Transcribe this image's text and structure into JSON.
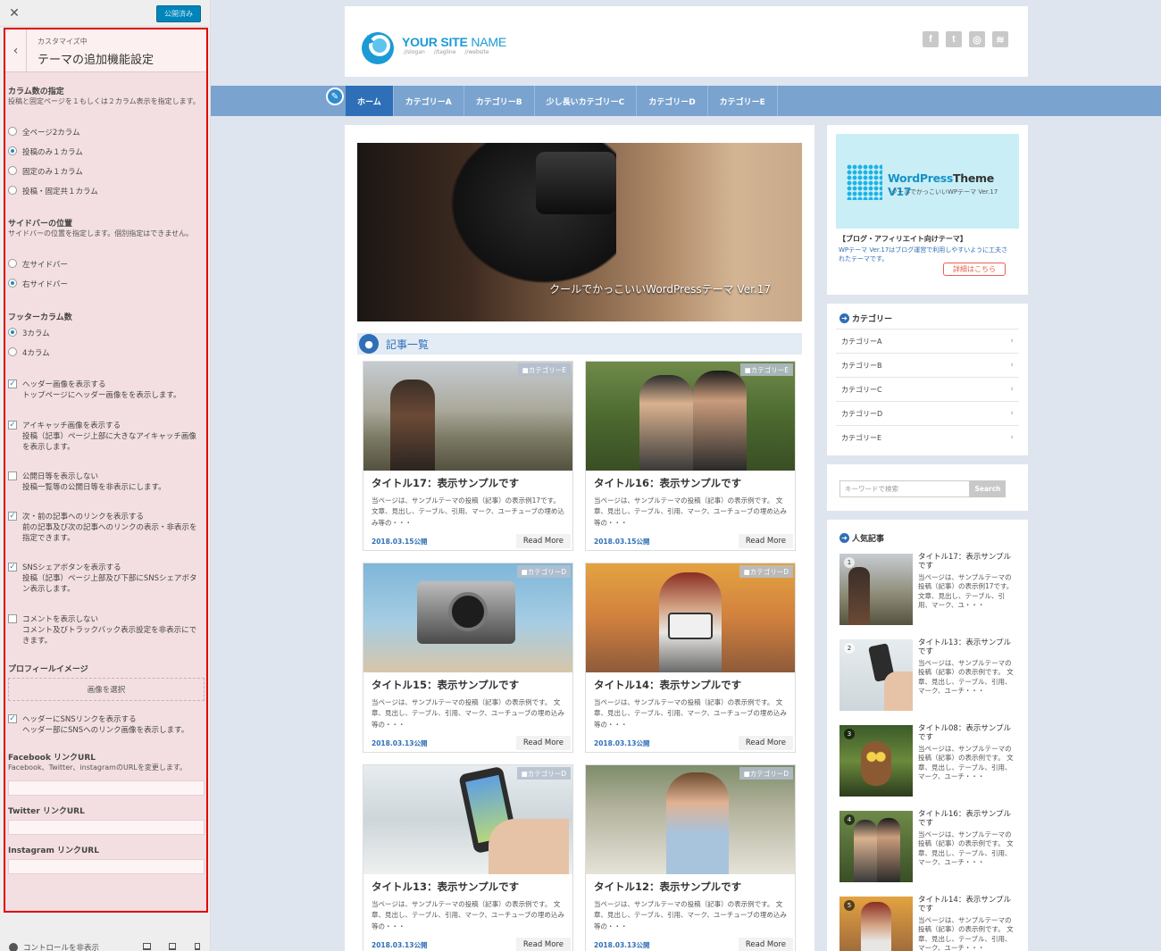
{
  "customizer": {
    "close_icon": "close-icon",
    "publish_label": "公開済み",
    "back_icon": "chevron-left-icon",
    "subtitle": "カスタマイズ中",
    "title": "テーマの追加機能設定",
    "column": {
      "heading": "カラム数の指定",
      "desc": "投稿と固定ページを１もしくは２カラム表示を指定します。",
      "options": [
        "全ページ2カラム",
        "投稿のみ１カラム",
        "固定のみ１カラム",
        "投稿・固定共１カラム"
      ],
      "selected": 1
    },
    "sidebar": {
      "heading": "サイドバーの位置",
      "desc": "サイドバーの位置を指定します。個別指定はできません。",
      "options": [
        "左サイドバー",
        "右サイドバー"
      ],
      "selected": 1
    },
    "footer": {
      "heading": "フッターカラム数",
      "options": [
        "3カラム",
        "4カラム"
      ],
      "selected": 0
    },
    "checks": [
      {
        "label": "ヘッダー画像を表示する",
        "desc": "トップページにヘッダー画像をを表示します。",
        "checked": true
      },
      {
        "label": "アイキャッチ画像を表示する",
        "desc": "投稿（記事）ページ上部に大きなアイキャッチ画像を表示します。",
        "checked": true
      },
      {
        "label": "公開日等を表示しない",
        "desc": "投稿一覧等の公開日等を非表示にします。",
        "checked": false
      },
      {
        "label": "次・前の記事へのリンクを表示する",
        "desc": "前の記事及び次の記事へのリンクの表示・非表示を指定できます。",
        "checked": true
      },
      {
        "label": "SNSシェアボタンを表示する",
        "desc": "投稿（記事）ページ上部及び下部にSNSシェアボタン表示します。",
        "checked": true
      },
      {
        "label": "コメントを表示しない",
        "desc": "コメント及びトラックバック表示設定を非表示にできます。",
        "checked": false
      }
    ],
    "profile": {
      "heading": "プロフィールイメージ",
      "button": "画像を選択"
    },
    "sns_check": {
      "label": "ヘッダーにSNSリンクを表示する",
      "desc": "ヘッダー部にSNSへのリンク画像を表示します。",
      "checked": true
    },
    "facebook": {
      "heading": "Facebook リンクURL",
      "desc": "Facebook、Twitter、instagramのURLを変更します。",
      "value": ""
    },
    "twitter": {
      "heading": "Twitter リンクURL",
      "value": ""
    },
    "instagram": {
      "heading": "Instagram リンクURL",
      "value": ""
    },
    "bottom": {
      "hide_label": "コントロールを非表示"
    }
  },
  "site": {
    "logo_main": "YOUR SITE",
    "logo_thin": "NAME",
    "logo_tags": "//slogan //tagline //website",
    "social": [
      "f",
      "t",
      "◎",
      "≋"
    ],
    "nav": [
      "ホーム",
      "カテゴリーA",
      "カテゴリーB",
      "少し長いカテゴリーC",
      "カテゴリーD",
      "カテゴリーE"
    ],
    "nav_active": 0,
    "hero_caption": "クールでかっこいいWordPressテーマ Ver.17",
    "section_title": "記事一覧",
    "posts": [
      {
        "title": "タイトル17：表示サンプルです",
        "excerpt": "当ページは、サンプルテーマの投稿（記事）の表示例17です。 文章、見出し、テーブル、引用、マーク、ユーチューブの埋め込み等の・・・",
        "date": "2018.03.15公開",
        "category": "カテゴリーE",
        "more": "Read More"
      },
      {
        "title": "タイトル16：表示サンプルです",
        "excerpt": "当ページは、サンプルテーマの投稿（記事）の表示例です。 文章、見出し、テーブル、引用、マーク、ユーチューブの埋め込み等の・・・",
        "date": "2018.03.15公開",
        "category": "カテゴリーE",
        "more": "Read More"
      },
      {
        "title": "タイトル15：表示サンプルです",
        "excerpt": "当ページは、サンプルテーマの投稿（記事）の表示例です。 文章、見出し、テーブル、引用、マーク、ユーチューブの埋め込み等の・・・",
        "date": "2018.03.13公開",
        "category": "カテゴリーD",
        "more": "Read More"
      },
      {
        "title": "タイトル14：表示サンプルです",
        "excerpt": "当ページは、サンプルテーマの投稿（記事）の表示例です。 文章、見出し、テーブル、引用、マーク、ユーチューブの埋め込み等の・・・",
        "date": "2018.03.13公開",
        "category": "カテゴリーD",
        "more": "Read More"
      },
      {
        "title": "タイトル13：表示サンプルです",
        "excerpt": "当ページは、サンプルテーマの投稿（記事）の表示例です。 文章、見出し、テーブル、引用、マーク、ユーチューブの埋め込み等の・・・",
        "date": "2018.03.13公開",
        "category": "カテゴリーD",
        "more": "Read More"
      },
      {
        "title": "タイトル12：表示サンプルです",
        "excerpt": "当ページは、サンプルテーマの投稿（記事）の表示例です。 文章、見出し、テーブル、引用、マーク、ユーチューブの埋め込み等の・・・",
        "date": "2018.03.13公開",
        "category": "カテゴリーD",
        "more": "Read More"
      }
    ],
    "ad": {
      "name_blue": "WordPress",
      "name_dark": "Theme",
      "name_ver": " V17",
      "sub": "クールでかっこいいWPテーマ Ver.17",
      "heading": "【ブログ・アフィリエイト向けテーマ】",
      "text": "WPテーマ Ver.17はブログ運営で利用しやすいように工夫されたテーマです。",
      "button": "詳細はこちら"
    },
    "categories": {
      "title": "カテゴリー",
      "items": [
        "カテゴリーA",
        "カテゴリーB",
        "カテゴリーC",
        "カテゴリーD",
        "カテゴリーE"
      ]
    },
    "search": {
      "placeholder": "キーワードで検索",
      "button": "Search"
    },
    "popular": {
      "title": "人気記事",
      "items": [
        {
          "rank": "1",
          "title": "タイトル17：表示サンプルです",
          "excerpt": "当ページは、サンプルテーマの投稿（記事）の表示例17です。 文章、見出し、テーブル、引用、マーク、ユ・・・"
        },
        {
          "rank": "2",
          "title": "タイトル13：表示サンプルです",
          "excerpt": "当ページは、サンプルテーマの投稿（記事）の表示例です。 文章、見出し、テーブル、引用、マーク、ユーチ・・・"
        },
        {
          "rank": "3",
          "title": "タイトル08：表示サンプルです",
          "excerpt": "当ページは、サンプルテーマの投稿（記事）の表示例です。 文章、見出し、テーブル、引用、マーク、ユーチ・・・"
        },
        {
          "rank": "4",
          "title": "タイトル16：表示サンプルです",
          "excerpt": "当ページは、サンプルテーマの投稿（記事）の表示例です。 文章、見出し、テーブル、引用、マーク、ユーチ・・・"
        },
        {
          "rank": "5",
          "title": "タイトル14：表示サンプルです",
          "excerpt": "当ページは、サンプルテーマの投稿（記事）の表示例です。 文章、見出し、テーブル、引用、マーク、ユーチ・・・"
        }
      ]
    }
  }
}
